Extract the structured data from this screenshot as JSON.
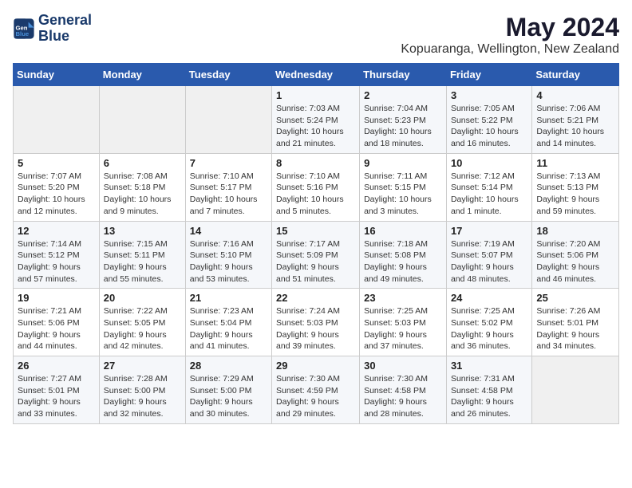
{
  "header": {
    "logo_line1": "General",
    "logo_line2": "Blue",
    "title": "May 2024",
    "subtitle": "Kopuaranga, Wellington, New Zealand"
  },
  "days_of_week": [
    "Sunday",
    "Monday",
    "Tuesday",
    "Wednesday",
    "Thursday",
    "Friday",
    "Saturday"
  ],
  "weeks": [
    [
      {
        "day": "",
        "info": ""
      },
      {
        "day": "",
        "info": ""
      },
      {
        "day": "",
        "info": ""
      },
      {
        "day": "1",
        "info": "Sunrise: 7:03 AM\nSunset: 5:24 PM\nDaylight: 10 hours\nand 21 minutes."
      },
      {
        "day": "2",
        "info": "Sunrise: 7:04 AM\nSunset: 5:23 PM\nDaylight: 10 hours\nand 18 minutes."
      },
      {
        "day": "3",
        "info": "Sunrise: 7:05 AM\nSunset: 5:22 PM\nDaylight: 10 hours\nand 16 minutes."
      },
      {
        "day": "4",
        "info": "Sunrise: 7:06 AM\nSunset: 5:21 PM\nDaylight: 10 hours\nand 14 minutes."
      }
    ],
    [
      {
        "day": "5",
        "info": "Sunrise: 7:07 AM\nSunset: 5:20 PM\nDaylight: 10 hours\nand 12 minutes."
      },
      {
        "day": "6",
        "info": "Sunrise: 7:08 AM\nSunset: 5:18 PM\nDaylight: 10 hours\nand 9 minutes."
      },
      {
        "day": "7",
        "info": "Sunrise: 7:10 AM\nSunset: 5:17 PM\nDaylight: 10 hours\nand 7 minutes."
      },
      {
        "day": "8",
        "info": "Sunrise: 7:10 AM\nSunset: 5:16 PM\nDaylight: 10 hours\nand 5 minutes."
      },
      {
        "day": "9",
        "info": "Sunrise: 7:11 AM\nSunset: 5:15 PM\nDaylight: 10 hours\nand 3 minutes."
      },
      {
        "day": "10",
        "info": "Sunrise: 7:12 AM\nSunset: 5:14 PM\nDaylight: 10 hours\nand 1 minute."
      },
      {
        "day": "11",
        "info": "Sunrise: 7:13 AM\nSunset: 5:13 PM\nDaylight: 9 hours\nand 59 minutes."
      }
    ],
    [
      {
        "day": "12",
        "info": "Sunrise: 7:14 AM\nSunset: 5:12 PM\nDaylight: 9 hours\nand 57 minutes."
      },
      {
        "day": "13",
        "info": "Sunrise: 7:15 AM\nSunset: 5:11 PM\nDaylight: 9 hours\nand 55 minutes."
      },
      {
        "day": "14",
        "info": "Sunrise: 7:16 AM\nSunset: 5:10 PM\nDaylight: 9 hours\nand 53 minutes."
      },
      {
        "day": "15",
        "info": "Sunrise: 7:17 AM\nSunset: 5:09 PM\nDaylight: 9 hours\nand 51 minutes."
      },
      {
        "day": "16",
        "info": "Sunrise: 7:18 AM\nSunset: 5:08 PM\nDaylight: 9 hours\nand 49 minutes."
      },
      {
        "day": "17",
        "info": "Sunrise: 7:19 AM\nSunset: 5:07 PM\nDaylight: 9 hours\nand 48 minutes."
      },
      {
        "day": "18",
        "info": "Sunrise: 7:20 AM\nSunset: 5:06 PM\nDaylight: 9 hours\nand 46 minutes."
      }
    ],
    [
      {
        "day": "19",
        "info": "Sunrise: 7:21 AM\nSunset: 5:06 PM\nDaylight: 9 hours\nand 44 minutes."
      },
      {
        "day": "20",
        "info": "Sunrise: 7:22 AM\nSunset: 5:05 PM\nDaylight: 9 hours\nand 42 minutes."
      },
      {
        "day": "21",
        "info": "Sunrise: 7:23 AM\nSunset: 5:04 PM\nDaylight: 9 hours\nand 41 minutes."
      },
      {
        "day": "22",
        "info": "Sunrise: 7:24 AM\nSunset: 5:03 PM\nDaylight: 9 hours\nand 39 minutes."
      },
      {
        "day": "23",
        "info": "Sunrise: 7:25 AM\nSunset: 5:03 PM\nDaylight: 9 hours\nand 37 minutes."
      },
      {
        "day": "24",
        "info": "Sunrise: 7:25 AM\nSunset: 5:02 PM\nDaylight: 9 hours\nand 36 minutes."
      },
      {
        "day": "25",
        "info": "Sunrise: 7:26 AM\nSunset: 5:01 PM\nDaylight: 9 hours\nand 34 minutes."
      }
    ],
    [
      {
        "day": "26",
        "info": "Sunrise: 7:27 AM\nSunset: 5:01 PM\nDaylight: 9 hours\nand 33 minutes."
      },
      {
        "day": "27",
        "info": "Sunrise: 7:28 AM\nSunset: 5:00 PM\nDaylight: 9 hours\nand 32 minutes."
      },
      {
        "day": "28",
        "info": "Sunrise: 7:29 AM\nSunset: 5:00 PM\nDaylight: 9 hours\nand 30 minutes."
      },
      {
        "day": "29",
        "info": "Sunrise: 7:30 AM\nSunset: 4:59 PM\nDaylight: 9 hours\nand 29 minutes."
      },
      {
        "day": "30",
        "info": "Sunrise: 7:30 AM\nSunset: 4:58 PM\nDaylight: 9 hours\nand 28 minutes."
      },
      {
        "day": "31",
        "info": "Sunrise: 7:31 AM\nSunset: 4:58 PM\nDaylight: 9 hours\nand 26 minutes."
      },
      {
        "day": "",
        "info": ""
      }
    ]
  ]
}
